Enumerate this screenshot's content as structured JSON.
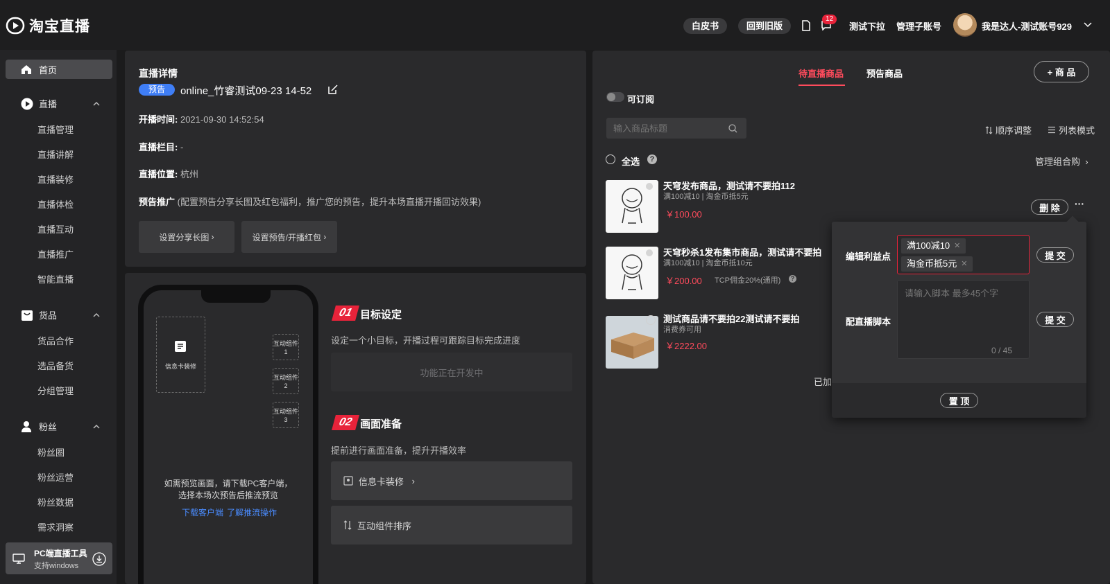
{
  "header": {
    "logo_text": "淘宝直播",
    "btn_whitepaper": "白皮书",
    "btn_old_version": "回到旧版",
    "notification_count": "12",
    "link_test_dropdown": "测试下拉",
    "link_manage_sub": "管理子账号",
    "account_name": "我是达人-测试账号929"
  },
  "sidebar": {
    "home": "首页",
    "live": {
      "label": "直播",
      "items": [
        "直播管理",
        "直播讲解",
        "直播装修",
        "直播体检",
        "直播互动",
        "直播推广",
        "智能直播"
      ]
    },
    "goods": {
      "label": "货品",
      "items": [
        "货品合作",
        "选品备货",
        "分组管理"
      ]
    },
    "fans": {
      "label": "粉丝",
      "items": [
        "粉丝圈",
        "粉丝运营",
        "粉丝数据",
        "需求洞察"
      ]
    },
    "pc_tool": {
      "title": "PC端直播工具",
      "subtitle": "支持windows"
    }
  },
  "details": {
    "heading": "直播详情",
    "tag": "预告",
    "title": "online_竹睿测试09-23 14-52",
    "start_label": "开播时间:",
    "start_value": "2021-09-30 14:52:54",
    "column_label": "直播栏目:",
    "column_value": "-",
    "location_label": "直播位置:",
    "location_value": "杭州",
    "promo_label": "预告推广",
    "promo_desc": "(配置预告分享长图及红包福利，推广您的预告，提升本场直播开播回访效果)",
    "btn_share_image": "设置分享长图",
    "btn_red_packet": "设置预告/开播红包"
  },
  "phone": {
    "info_card": "信息卡装修",
    "components": [
      "互动组件1",
      "互动组件2",
      "互动组件3"
    ],
    "preview_hint_line1": "如需预览画面，请下载PC客户端，",
    "preview_hint_line2": "选择本场次预告后推流预览",
    "link_download": "下载客户端",
    "link_learn": "了解推流操作"
  },
  "steps": {
    "step1": {
      "num": "01",
      "title": "目标设定",
      "desc": "设定一个小目标，开播过程可跟踪目标完成进度",
      "box": "功能正在开发中"
    },
    "step2": {
      "num": "02",
      "title": "画面准备",
      "desc": "提前进行画面准备，提升开播效率",
      "row1": "信息卡装修",
      "row2": "互动组件排序"
    }
  },
  "products_panel": {
    "tab_pending": "待直播商品",
    "tab_preview": "预告商品",
    "add_btn": "+ 商 品",
    "subscribe_label": "可订阅",
    "search_placeholder": "输入商品标题",
    "sort_adjust": "顺序调整",
    "list_mode": "列表模式",
    "select_all": "全选",
    "manage_combo": "管理组合购",
    "partial_text": "已加",
    "items": [
      {
        "title": "天穹发布商品，测试请不要拍112",
        "sub": "满100减10 |   淘金币抵5元",
        "price": "￥100.00",
        "extra": ""
      },
      {
        "title": "天穹秒杀1发布集市商品，测试请不要拍",
        "sub": "满100减10 |   淘金币抵10元",
        "price": "￥200.00",
        "extra": "TCP佣金20%(通用)"
      },
      {
        "title": "测试商品请不要拍22测试请不要拍",
        "sub": "消费券可用",
        "price": "￥2222.00",
        "extra": ""
      }
    ],
    "btn_delete": "删 除",
    "more": "···"
  },
  "popover": {
    "edit_benefit_label": "编辑利益点",
    "chips": [
      "满100减10",
      "淘金币抵5元"
    ],
    "submit": "提 交",
    "script_label": "配直播脚本",
    "script_placeholder": "请输入脚本 最多45个字",
    "script_count": "0 / 45",
    "pin_top": "置 顶"
  },
  "colors": {
    "accent_red": "#e8233a",
    "price_red": "#ff4b5c",
    "blue": "#3f7ef6",
    "link_blue": "#4a8cff"
  }
}
